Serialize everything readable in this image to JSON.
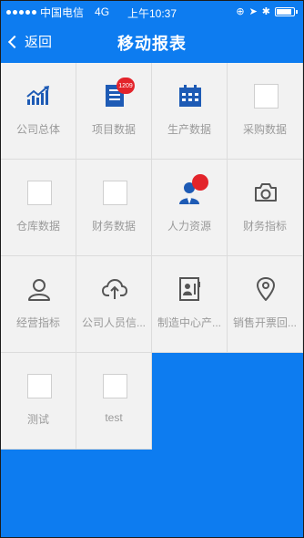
{
  "status_bar": {
    "carrier": "中国电信",
    "network": "4G",
    "time": "上午10:37"
  },
  "nav": {
    "back_label": "返回",
    "title": "移动报表"
  },
  "colors": {
    "primary": "#0d7cf0",
    "tile_bg": "#f2f2f2",
    "label": "#9a9a9a",
    "badge": "#e3242b"
  },
  "tiles": [
    {
      "label": "公司总体",
      "icon": "trend-chart-icon"
    },
    {
      "label": "项目数据",
      "icon": "document-icon",
      "badge": "1209"
    },
    {
      "label": "生产数据",
      "icon": "calendar-icon"
    },
    {
      "label": "采购数据",
      "icon": "placeholder-icon"
    },
    {
      "label": "仓库数据",
      "icon": "placeholder-icon"
    },
    {
      "label": "财务数据",
      "icon": "placeholder-icon"
    },
    {
      "label": "人力资源",
      "icon": "person-icon"
    },
    {
      "label": "财务指标",
      "icon": "camera-icon"
    },
    {
      "label": "经营指标",
      "icon": "user-outline-icon"
    },
    {
      "label": "公司人员信...",
      "icon": "cloud-upload-icon"
    },
    {
      "label": "制造中心产...",
      "icon": "contact-card-icon"
    },
    {
      "label": "销售开票回...",
      "icon": "location-pin-icon"
    },
    {
      "label": "测试",
      "icon": "placeholder-icon"
    },
    {
      "label": "test",
      "icon": "placeholder-icon"
    }
  ]
}
